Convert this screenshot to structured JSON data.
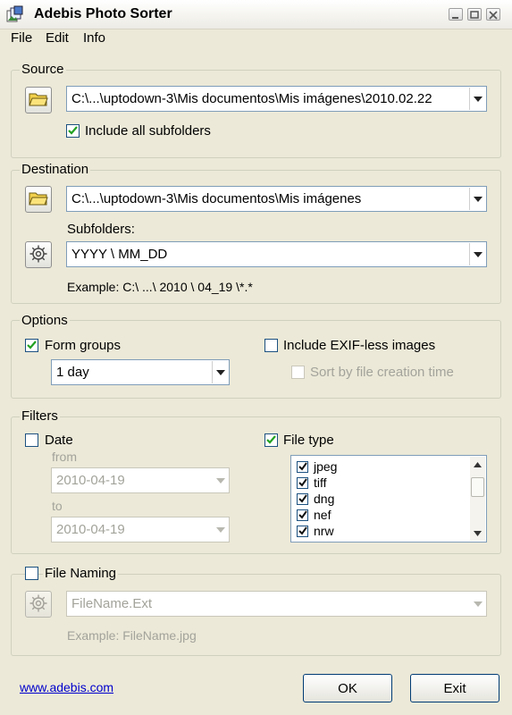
{
  "window": {
    "title": "Adebis Photo Sorter"
  },
  "menu": [
    "File",
    "Edit",
    "Info"
  ],
  "source": {
    "legend": "Source",
    "path": "C:\\...\\uptodown-3\\Mis documentos\\Mis imágenes\\2010.02.22",
    "include_subfolders_label": "Include all subfolders",
    "include_subfolders_checked": true
  },
  "destination": {
    "legend": "Destination",
    "path": "C:\\...\\uptodown-3\\Mis documentos\\Mis imágenes",
    "subfolders_label": "Subfolders:",
    "subfolders_value": "YYYY \\ MM_DD",
    "example": "Example: C:\\ ...\\ 2010 \\ 04_19 \\*.*"
  },
  "options": {
    "legend": "Options",
    "form_groups_label": "Form groups",
    "form_groups_checked": true,
    "group_interval": "1 day",
    "include_exifless_label": "Include EXIF-less images",
    "include_exifless_checked": false,
    "sort_by_creation_label": "Sort by file creation time",
    "sort_by_creation_checked": false
  },
  "filters": {
    "legend": "Filters",
    "date_label": "Date",
    "date_checked": false,
    "from_label": "from",
    "from_value": "2010-04-19",
    "to_label": "to",
    "to_value": "2010-04-19",
    "file_type_label": "File type",
    "file_type_checked": true,
    "file_types": [
      {
        "name": "jpeg",
        "checked": true
      },
      {
        "name": "tiff",
        "checked": true
      },
      {
        "name": "dng",
        "checked": true
      },
      {
        "name": "nef",
        "checked": true
      },
      {
        "name": "nrw",
        "checked": true
      }
    ]
  },
  "file_naming": {
    "label": "File Naming",
    "checked": false,
    "pattern": "FileName.Ext",
    "example": "Example: FileName.jpg"
  },
  "footer": {
    "link": "www.adebis.com",
    "ok_label": "OK",
    "exit_label": "Exit"
  },
  "icons": [
    "app-icon",
    "folder-icon",
    "gear-icon",
    "check-icon",
    "dropdown-arrow-icon"
  ],
  "colors": {
    "window_bg": "#ece9d8",
    "border_blue": "#7f9db9",
    "check_green": "#21a121",
    "link": "#0000cc"
  }
}
